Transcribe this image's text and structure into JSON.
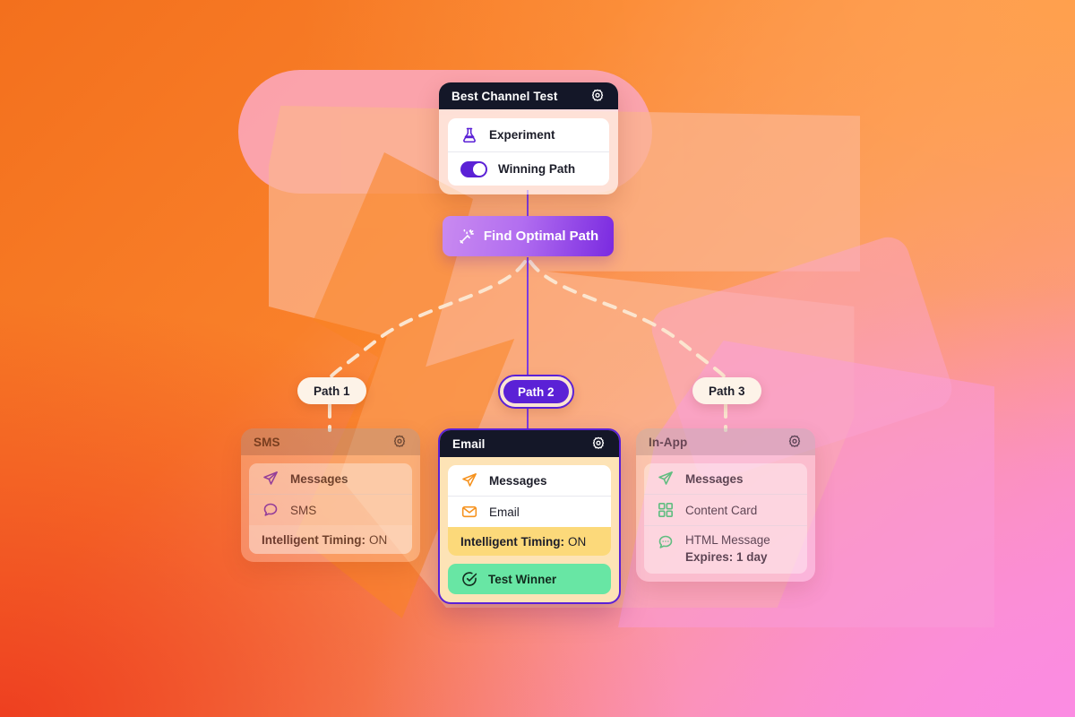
{
  "theme": {
    "accent_purple": "#5B21D6",
    "accent_orange": "#F6921E",
    "accent_green": "#21C96A",
    "winner_green": "#68E6A4",
    "timing_yellow": "#FCD97A",
    "header_dark": "#141728",
    "bg_orange": "#F3701D",
    "bg_red": "#EE3F20",
    "bg_pink": "#FB8CE2",
    "bg_amber": "#FFA04D"
  },
  "best_channel_test": {
    "title": "Best Channel Test",
    "gear_icon": "gear-icon",
    "rows": [
      {
        "icon": "flask-icon",
        "label": "Experiment",
        "bold": true
      },
      {
        "icon": "toggle-on",
        "label": "Winning Path",
        "bold": true
      }
    ]
  },
  "find_optimal": {
    "label": "Find Optimal Path",
    "icon": "magic-wand-icon"
  },
  "paths": [
    {
      "id": "path-1",
      "label": "Path 1",
      "selected": false
    },
    {
      "id": "path-2",
      "label": "Path 2",
      "selected": true
    },
    {
      "id": "path-3",
      "label": "Path 3",
      "selected": false
    }
  ],
  "channels": [
    {
      "id": "sms",
      "title": "SMS",
      "gear_icon": "gear-icon",
      "rows": [
        {
          "icon": "paper-plane-icon",
          "label": "Messages",
          "bold": true
        },
        {
          "icon": "chat-bubble-icon",
          "label": "SMS",
          "bold": false
        }
      ],
      "timing_label": "Intelligent Timing:",
      "timing_value": "ON"
    },
    {
      "id": "email",
      "title": "Email",
      "gear_icon": "gear-icon",
      "rows": [
        {
          "icon": "paper-plane-icon",
          "label": "Messages",
          "bold": true
        },
        {
          "icon": "envelope-icon",
          "label": "Email",
          "bold": false
        }
      ],
      "timing_label": "Intelligent Timing:",
      "timing_value": "ON",
      "badge": {
        "icon": "check-circle-icon",
        "label": "Test Winner"
      }
    },
    {
      "id": "inapp",
      "title": "In-App",
      "gear_icon": "gear-icon",
      "rows": [
        {
          "icon": "paper-plane-icon",
          "label": "Messages",
          "bold": true
        },
        {
          "icon": "grid-icon",
          "label": "Content Card",
          "bold": false
        }
      ],
      "html_row": {
        "icon": "chat-dots-icon",
        "label": "HTML Message",
        "expires": "Expires: 1 day"
      }
    }
  ]
}
